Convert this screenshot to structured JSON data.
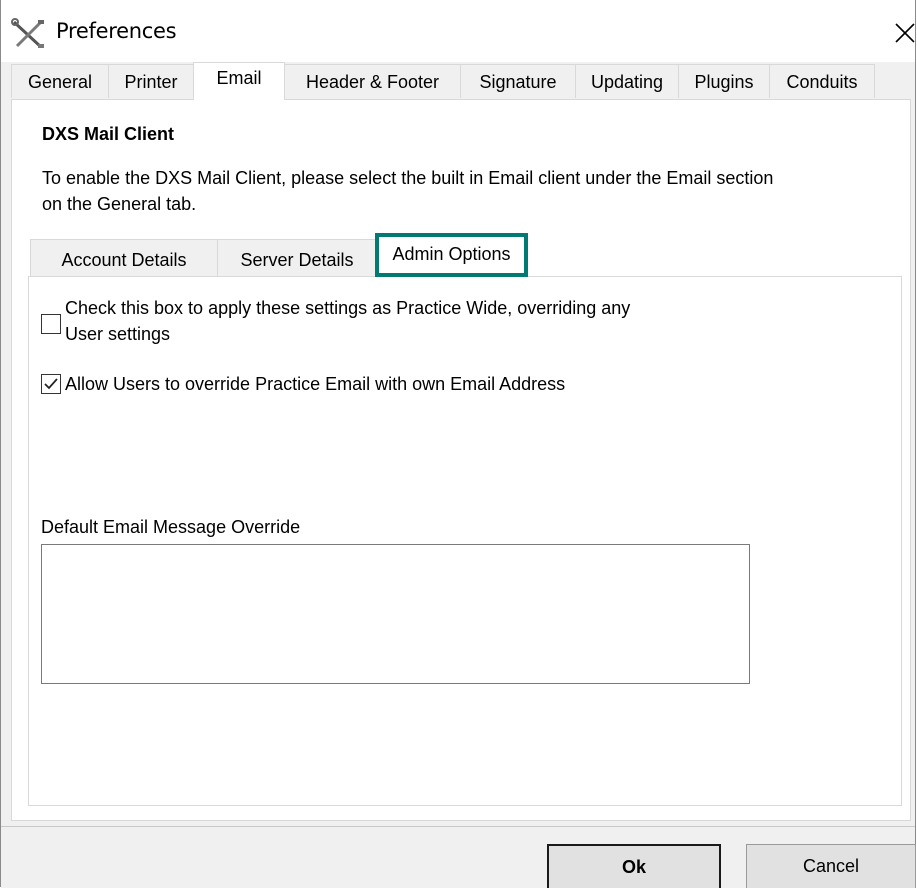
{
  "window": {
    "title": "Preferences",
    "app_icon": "tools-icon",
    "close_icon": "close-icon"
  },
  "main_tabs": [
    {
      "label": "General",
      "active": false
    },
    {
      "label": "Printer",
      "active": false
    },
    {
      "label": "Email",
      "active": true
    },
    {
      "label": "Header & Footer",
      "active": false
    },
    {
      "label": "Signature",
      "active": false
    },
    {
      "label": "Updating",
      "active": false
    },
    {
      "label": "Plugins",
      "active": false
    },
    {
      "label": "Conduits",
      "active": false
    }
  ],
  "email": {
    "section_title": "DXS Mail Client",
    "info_line1": "To enable the DXS Mail Client, please select the built in Email client under the Email section",
    "info_line2": "on the General tab.",
    "inner_tabs": [
      {
        "label": "Account Details",
        "active": false
      },
      {
        "label": "Server Details",
        "active": false
      },
      {
        "label": "Admin Options",
        "active": true
      }
    ],
    "highlight_color": "#007a73",
    "admin": {
      "practice_wide_line1": "Check this box to apply these settings as Practice Wide, overriding any",
      "practice_wide_line2": "User settings",
      "practice_wide_checked": false,
      "allow_override_label": "Allow Users to override Practice Email with own Email Address",
      "allow_override_checked": true,
      "default_message_label": "Default Email Message Override",
      "default_message_value": ""
    }
  },
  "buttons": {
    "ok": "Ok",
    "cancel": "Cancel"
  }
}
